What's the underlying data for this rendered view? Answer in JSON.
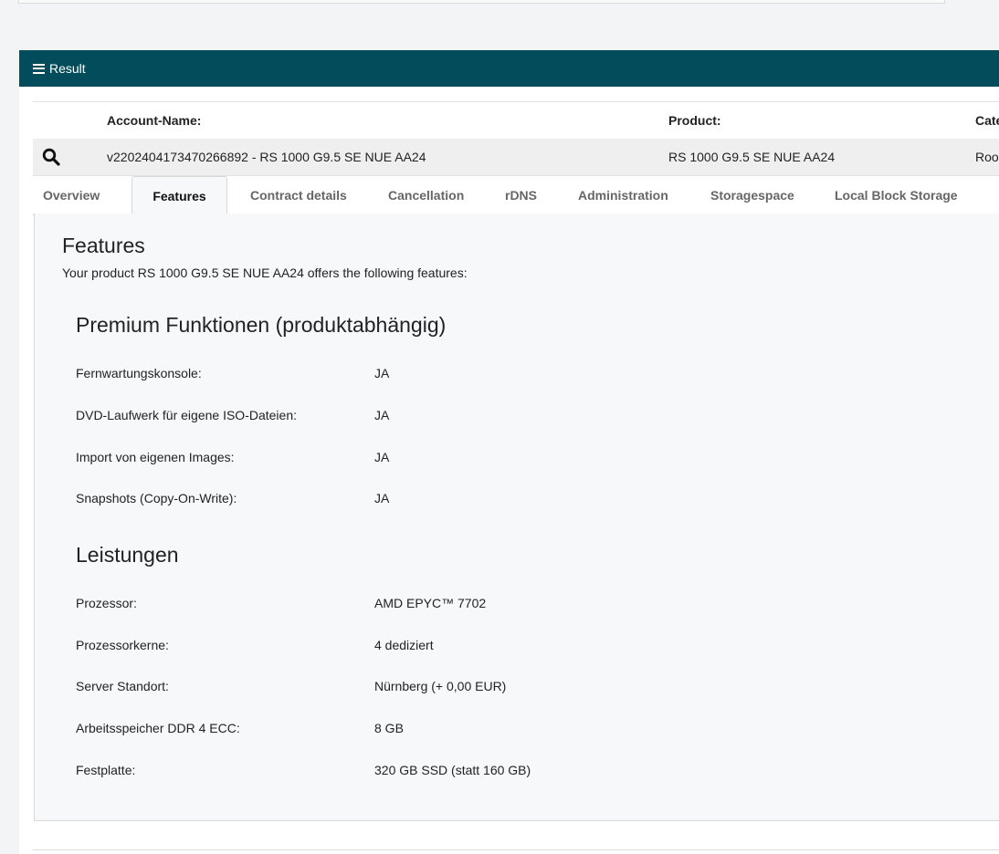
{
  "result_bar": {
    "label": "Result",
    "icon": "list-icon",
    "color": "#024c5c"
  },
  "table": {
    "headers": {
      "account_name": "Account-Name:",
      "product": "Product:",
      "category": "Cate"
    },
    "row": {
      "account_name": "v2202404173470266892 - RS 1000 G9.5 SE NUE AA24",
      "product": "RS 1000 G9.5 SE NUE AA24",
      "category": "Roo"
    }
  },
  "tabs": [
    {
      "label": "Overview"
    },
    {
      "label": "Features"
    },
    {
      "label": "Contract details"
    },
    {
      "label": "Cancellation"
    },
    {
      "label": "rDNS"
    },
    {
      "label": "Administration"
    },
    {
      "label": "Storagespace"
    },
    {
      "label": "Local Block Storage"
    }
  ],
  "active_tab": "Features",
  "features": {
    "title": "Features",
    "intro": "Your product RS 1000 G9.5 SE NUE AA24 offers the following features:",
    "sections": [
      {
        "title": "Premium Funktionen (produktabhängig)",
        "rows": [
          {
            "label": "Fernwartungskonsole:",
            "value": "JA"
          },
          {
            "label": "DVD-Laufwerk für eigene ISO-Dateien:",
            "value": "JA"
          },
          {
            "label": "Import von eigenen Images:",
            "value": "JA"
          },
          {
            "label": "Snapshots (Copy-On-Write):",
            "value": "JA"
          }
        ]
      },
      {
        "title": "Leistungen",
        "rows": [
          {
            "label": "Prozessor:",
            "value": "AMD EPYC™ 7702"
          },
          {
            "label": "Prozessorkerne:",
            "value": "4 dediziert"
          },
          {
            "label": "Server Standort:",
            "value": "Nürnberg (+ 0,00 EUR)"
          },
          {
            "label": "Arbeitsspeicher DDR 4 ECC:",
            "value": "8 GB"
          },
          {
            "label": "Festplatte:",
            "value": "320 GB SSD (statt 160 GB)"
          }
        ]
      }
    ]
  }
}
